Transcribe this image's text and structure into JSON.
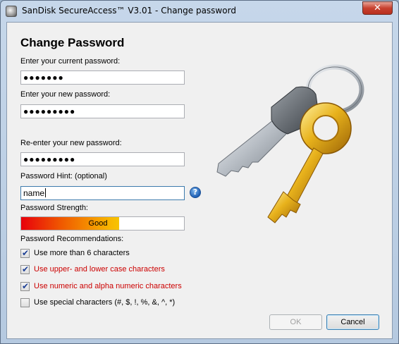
{
  "window": {
    "title": "SanDisk SecureAccess™ V3.01 - Change password",
    "close_glyph": "✕"
  },
  "form": {
    "heading": "Change Password",
    "current_label": "Enter your current password:",
    "current_value": "●●●●●●●",
    "new_label": "Enter your new password:",
    "new_value": "●●●●●●●●●",
    "reenter_label": "Re-enter your new password:",
    "reenter_value": "●●●●●●●●●",
    "hint_label": "Password Hint: (optional)",
    "hint_value": "name",
    "help_glyph": "?",
    "strength_label": "Password Strength:",
    "strength_text": "Good",
    "strength_fraction": 0.6,
    "recommendations_label": "Password Recommendations:"
  },
  "recommendations": [
    {
      "text": "Use more than 6 characters",
      "checked": true,
      "color": "#000000"
    },
    {
      "text": "Use upper- and lower case characters",
      "checked": true,
      "color": "#cc0000"
    },
    {
      "text": "Use numeric and alpha numeric characters",
      "checked": true,
      "color": "#cc0000"
    },
    {
      "text": "Use special characters (#, $, !, %, &, ^, *)",
      "checked": false,
      "color": "#000000"
    }
  ],
  "buttons": {
    "ok": "OK",
    "ok_enabled": false,
    "cancel": "Cancel"
  },
  "icons": {
    "app": "sandisk-app-icon",
    "keys": "keys-illustration",
    "help": "help-icon"
  }
}
